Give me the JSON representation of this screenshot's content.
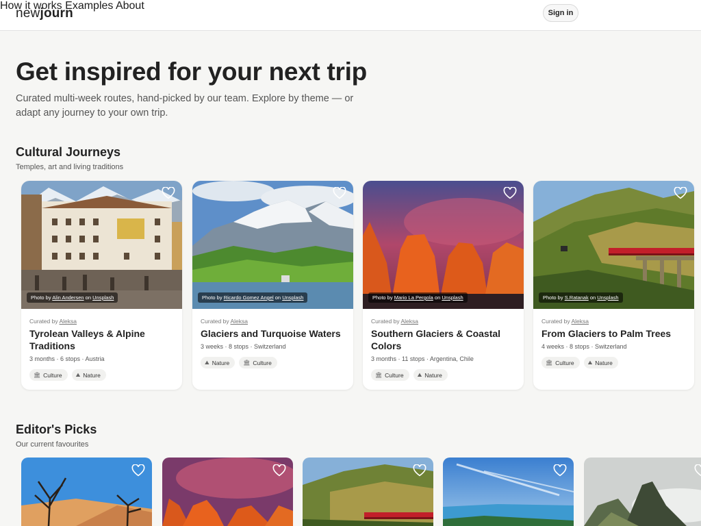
{
  "header": {
    "logo_light": "new",
    "logo_bold": "journ",
    "nav": [
      "How it works",
      "Examples",
      "About"
    ],
    "signin": "Sign in"
  },
  "hero": {
    "title": "Get inspired for your next trip",
    "subtitle": "Curated multi-week routes, hand-picked by our team. Explore by theme — or adapt any journey to your own trip."
  },
  "cultural": {
    "title": "Cultural Journeys",
    "subtitle": "Temples, art and living traditions",
    "cards": [
      {
        "photographer": "Alin Andersen",
        "curator": "Aleksa",
        "title": "Tyrolean Valleys & Alpine Traditions",
        "meta": "3 months · 6 stops · Austria",
        "tags": [
          "Culture",
          "Nature"
        ]
      },
      {
        "photographer": "Ricardo Gomez Angel",
        "curator": "Aleksa",
        "title": "Glaciers and Turquoise Waters",
        "meta": "3 weeks · 8 stops · Switzerland",
        "tags": [
          "Nature",
          "Culture"
        ]
      },
      {
        "photographer": "Mario La Pergola",
        "curator": "Aleksa",
        "title": "Southern Glaciers & Coastal Colors",
        "meta": "3 months · 11 stops · Argentina, Chile",
        "tags": [
          "Culture",
          "Nature"
        ]
      },
      {
        "photographer": "S.Ratanak",
        "curator": "Aleksa",
        "title": "From Glaciers to Palm Trees",
        "meta": "4 weeks · 8 stops · Switzerland",
        "tags": [
          "Culture",
          "Nature"
        ]
      }
    ]
  },
  "labels": {
    "photo_by": "Photo by",
    "on": "on",
    "unsplash": "Unsplash",
    "curated_by": "Curated by"
  },
  "picks": {
    "title": "Editor's Picks",
    "subtitle": "Our current favourites"
  },
  "icons": {
    "favorite": "heart-outline-icon",
    "culture": "temple-icon",
    "nature": "mountain-icon"
  }
}
